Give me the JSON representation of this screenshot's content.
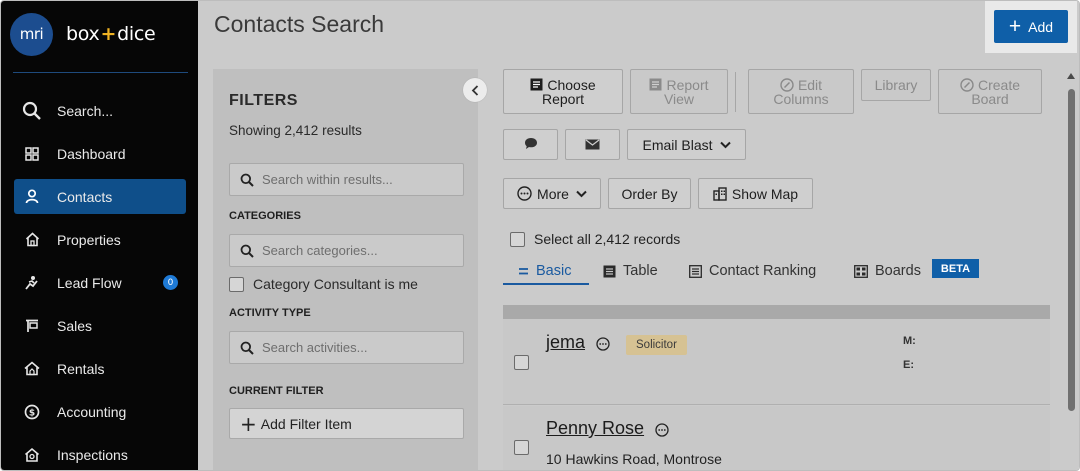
{
  "brand": {
    "logo_text": "mri",
    "name_left": "box",
    "name_plus": "+",
    "name_right": "dice"
  },
  "sidebar": {
    "items": [
      {
        "label": "Search...",
        "icon": "search-icon"
      },
      {
        "label": "Dashboard",
        "icon": "dashboard-icon"
      },
      {
        "label": "Contacts",
        "icon": "person-icon",
        "active": true
      },
      {
        "label": "Properties",
        "icon": "house-icon"
      },
      {
        "label": "Lead Flow",
        "icon": "lead-flow-icon",
        "badge": "0"
      },
      {
        "label": "Sales",
        "icon": "sales-sign-icon"
      },
      {
        "label": "Rentals",
        "icon": "rentals-house-icon"
      },
      {
        "label": "Accounting",
        "icon": "dollar-circle-icon"
      },
      {
        "label": "Inspections",
        "icon": "inspections-icon"
      }
    ]
  },
  "header": {
    "title": "Contacts Search",
    "add_label": "Add"
  },
  "filters": {
    "title": "FILTERS",
    "count_text": "Showing 2,412 results",
    "search_placeholder": "Search within results...",
    "categories_heading": "CATEGORIES",
    "categories_placeholder": "Search categories...",
    "consultant_checkbox_label": "Category Consultant is me",
    "activity_heading": "ACTIVITY TYPE",
    "activity_placeholder": "Search activities...",
    "current_filter_heading": "CURRENT FILTER",
    "add_filter_label": "Add Filter Item"
  },
  "toolbar": {
    "choose_report_1": "Choose",
    "choose_report_2": "Report",
    "report_view_1": "Report",
    "report_view_2": "View",
    "edit_columns_1": "Edit",
    "edit_columns_2": "Columns",
    "library": "Library",
    "create_board_1": "Create",
    "create_board_2": "Board",
    "email_blast": "Email Blast",
    "more": "More",
    "order_by": "Order By",
    "show_map": "Show Map"
  },
  "select_all_label": "Select all 2,412 records",
  "tabs": [
    {
      "label": "Basic",
      "active": true
    },
    {
      "label": "Table"
    },
    {
      "label": "Contact Ranking"
    },
    {
      "label": "Boards"
    }
  ],
  "beta_badge": "BETA",
  "contacts": [
    {
      "name": "jema",
      "tag": "Solicitor",
      "meta_m": "M:",
      "meta_e": "E:"
    },
    {
      "name": "Penny Rose",
      "address": "10 Hawkins Road, Montrose"
    }
  ],
  "colors": {
    "sidebar_bg": "#060606",
    "accent": "#0f5fa8",
    "active_nav": "#0f4f8a",
    "tag_bg": "#d6c293"
  }
}
